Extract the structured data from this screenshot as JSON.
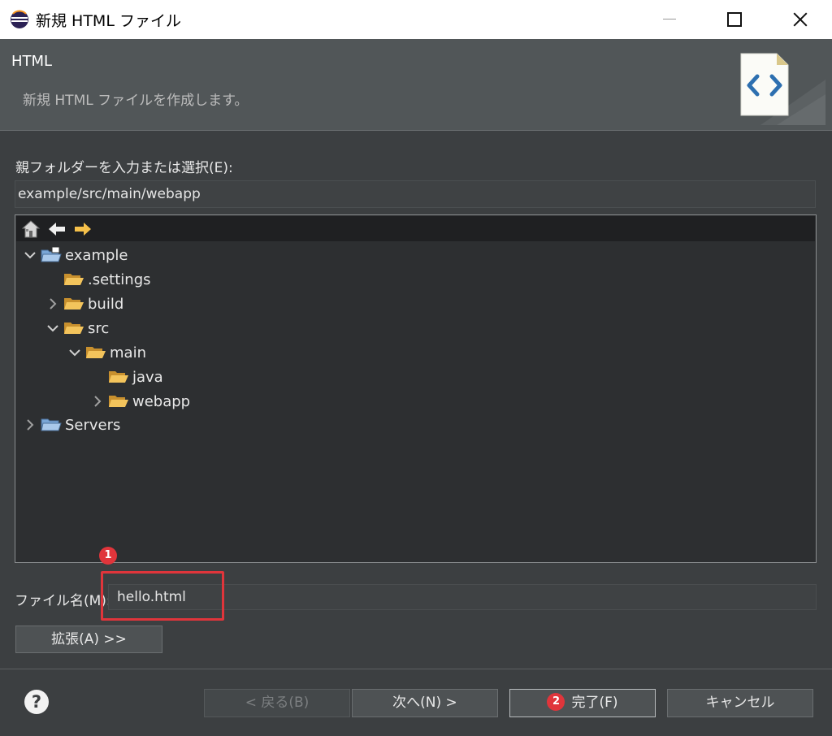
{
  "window": {
    "title": "新規 HTML ファイル"
  },
  "banner": {
    "title": "HTML",
    "description": "新規 HTML ファイルを作成します。"
  },
  "parent_folder": {
    "label": "親フォルダーを入力または選択(E):",
    "value": "example/src/main/webapp"
  },
  "tree": {
    "toolbar_icons": [
      "home-icon",
      "back-arrow-icon",
      "forward-arrow-icon"
    ],
    "items": [
      {
        "label": "example",
        "expanded": true,
        "icon": "project-folder-icon"
      },
      {
        "label": ".settings",
        "expanded": null,
        "icon": "folder-icon"
      },
      {
        "label": "build",
        "expanded": false,
        "icon": "folder-icon"
      },
      {
        "label": "src",
        "expanded": true,
        "icon": "folder-icon"
      },
      {
        "label": "main",
        "expanded": true,
        "icon": "folder-icon"
      },
      {
        "label": "java",
        "expanded": null,
        "icon": "folder-icon"
      },
      {
        "label": "webapp",
        "expanded": false,
        "icon": "folder-icon"
      },
      {
        "label": "Servers",
        "expanded": false,
        "icon": "project-folder-icon"
      }
    ]
  },
  "file_name": {
    "label": "ファイル名(M):",
    "value": "hello.html"
  },
  "annotations": {
    "badge_1": "1",
    "badge_2": "2",
    "highlight_color": "#e0353b"
  },
  "buttons": {
    "advanced": "拡張(A) >>",
    "back": "< 戻る(B)",
    "next": "次へ(N) >",
    "finish": "完了(F)",
    "cancel": "キャンセル",
    "help": "?"
  },
  "colors": {
    "background": "#3c3f41",
    "banner": "#515658",
    "tree_background": "#2d2f31",
    "folder": "#e8b64c"
  }
}
